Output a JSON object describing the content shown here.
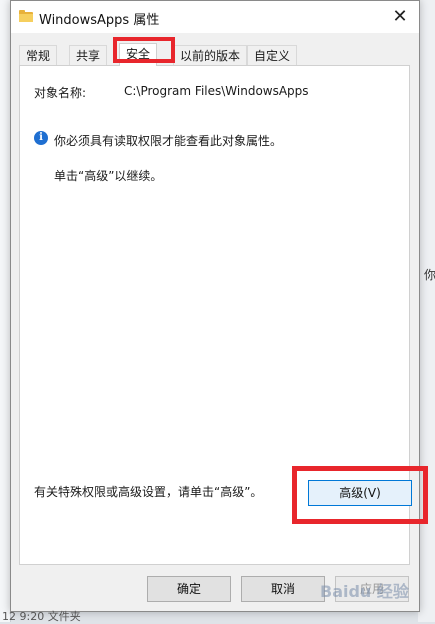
{
  "window": {
    "title": "WindowsApps 属性",
    "close_glyph": "✕"
  },
  "tabs": [
    {
      "label": "常规"
    },
    {
      "label": "共享"
    },
    {
      "label": "安全"
    },
    {
      "label": "以前的版本"
    },
    {
      "label": "自定义"
    }
  ],
  "active_tab": "安全",
  "security": {
    "object_name_label": "对象名称:",
    "object_name_value": "C:\\Program Files\\WindowsApps",
    "info_message": "你必须具有读取权限才能查看此对象属性。",
    "continue_message": "单击“高级”以继续。",
    "special_permissions_text": "有关特殊权限或高级设置，请单击“高级”。",
    "advanced_button": "高级(V)"
  },
  "footer_buttons": {
    "ok": "确定",
    "cancel": "取消",
    "apply": "应用"
  },
  "background": {
    "right_hint": "你",
    "bottom_text": "12 9:20    文件夹"
  },
  "watermark": "Baidu 经验",
  "colors": {
    "highlight_red": "#e8262c",
    "info_blue": "#1f6fd1",
    "primary_button_border": "#0078d7"
  }
}
